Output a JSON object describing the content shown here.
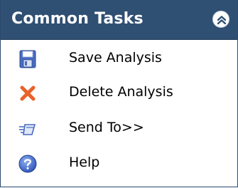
{
  "panel": {
    "title": "Common Tasks",
    "collapse_icon": "chevron-double-up-icon"
  },
  "tasks": [
    {
      "label": "Save Analysis",
      "icon": "floppy-disk-icon"
    },
    {
      "label": "Delete Analysis",
      "icon": "red-x-icon"
    },
    {
      "label": "Send To>>",
      "icon": "send-arrow-icon"
    },
    {
      "label": "Help",
      "icon": "help-icon"
    }
  ],
  "colors": {
    "header_bg": "#2f4f73",
    "header_text": "#ffffff",
    "delete_red": "#e8622a",
    "help_blue": "#3a63c8"
  }
}
